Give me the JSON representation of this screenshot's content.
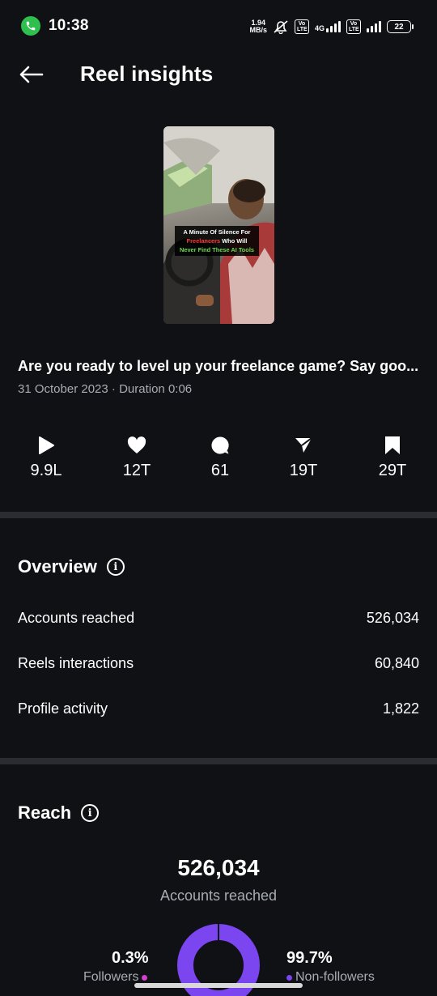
{
  "status_bar": {
    "time": "10:38",
    "net_speed_value": "1.94",
    "net_speed_unit": "MB/s",
    "network": "4G",
    "volte1": "Vo LTE",
    "volte2": "Vo LTE",
    "battery": "22"
  },
  "header": {
    "title": "Reel insights",
    "back_icon": "arrow-left-icon"
  },
  "reel": {
    "thumbnail_caption_line1_a": "A Minute Of Silence For",
    "thumbnail_caption_line2_a": "Freelancers",
    "thumbnail_caption_line2_b": " Who Will",
    "thumbnail_caption_line3": "Never Find These AI Tools",
    "caption": "Are you ready to level up your freelance game? Say goo...",
    "meta": "31 October 2023 · Duration 0:06"
  },
  "stats": [
    {
      "icon": "play-icon",
      "value": "9.9L"
    },
    {
      "icon": "heart-icon",
      "value": "12T"
    },
    {
      "icon": "comment-icon",
      "value": "61"
    },
    {
      "icon": "share-icon",
      "value": "19T"
    },
    {
      "icon": "bookmark-icon",
      "value": "29T"
    }
  ],
  "overview": {
    "title": "Overview",
    "rows": [
      {
        "label": "Accounts reached",
        "value": "526,034"
      },
      {
        "label": "Reels interactions",
        "value": "60,840"
      },
      {
        "label": "Profile activity",
        "value": "1,822"
      }
    ]
  },
  "reach": {
    "title": "Reach",
    "value": "526,034",
    "label": "Accounts reached",
    "followers_pct": "0.3%",
    "followers_label": "Followers",
    "non_followers_pct": "99.7%",
    "non_followers_label": "Non-followers",
    "followers_fraction": 0.003,
    "colors": {
      "followers": "#d43fd0",
      "non_followers": "#7b45f0"
    }
  }
}
